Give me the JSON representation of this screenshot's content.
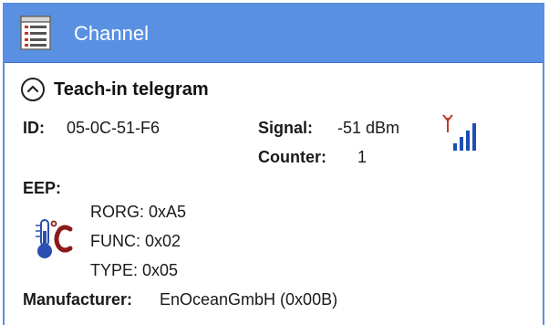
{
  "window": {
    "title": "Channel"
  },
  "section": {
    "title": "Teach-in telegram"
  },
  "telegram": {
    "id_label": "ID:",
    "id_value": "05-0C-51-F6",
    "signal_label": "Signal:",
    "signal_value": "-51 dBm",
    "counter_label": "Counter:",
    "counter_value": "1",
    "eep_label": "EEP:",
    "rorg": "RORG: 0xA5",
    "func": "FUNC: 0x02",
    "type": "TYPE:  0x05",
    "manufacturer_label": "Manufacturer:",
    "manufacturer_value": "EnOceanGmbH (0x00B)"
  },
  "icons": {
    "title": "list-document-icon",
    "toggle": "chevron-up-circle-icon",
    "signal": "signal-strength-icon",
    "eep": "thermometer-celsius-icon"
  },
  "colors": {
    "titlebar": "#5a90e2",
    "signal_bars": "#1b4fb8",
    "antenna": "#c0392b",
    "thermo_red": "#8b1a1a",
    "thermo_blue": "#2a4fb0"
  }
}
